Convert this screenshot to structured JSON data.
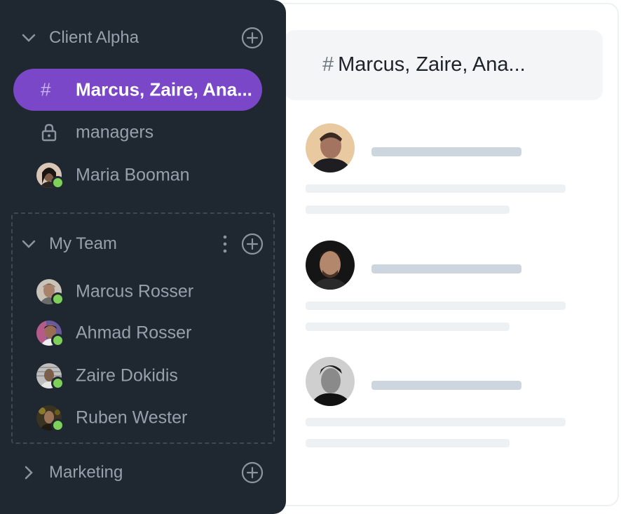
{
  "sidebar": {
    "groups": [
      {
        "label": "Client Alpha",
        "expanded": true,
        "items": [
          {
            "label": "Marcus, Zaire, Ana...",
            "type": "channel",
            "icon": "hash-icon",
            "active": true
          },
          {
            "label": "managers",
            "type": "private-channel",
            "icon": "lock-icon"
          },
          {
            "label": "Maria Booman",
            "type": "direct",
            "status": "online"
          }
        ]
      },
      {
        "label": "My Team",
        "expanded": true,
        "items": [
          {
            "label": "Marcus Rosser",
            "status": "online"
          },
          {
            "label": "Ahmad Rosser",
            "status": "online"
          },
          {
            "label": "Zaire Dokidis",
            "status": "online"
          },
          {
            "label": "Ruben Wester",
            "status": "online"
          }
        ]
      },
      {
        "label": "Marketing",
        "expanded": false,
        "items": []
      }
    ]
  },
  "chat": {
    "hash": "#",
    "title": "Marcus, Zaire, Ana...",
    "messages": [
      {
        "avatar": "user-avatar"
      },
      {
        "avatar": "user-avatar"
      },
      {
        "avatar": "user-avatar"
      }
    ]
  },
  "colors": {
    "sidebar_bg": "#1f2730",
    "active_bg": "#7a47c9",
    "online": "#7ed05a",
    "skeleton_dark": "#cdd6de",
    "skeleton_light": "#eef1f4"
  }
}
